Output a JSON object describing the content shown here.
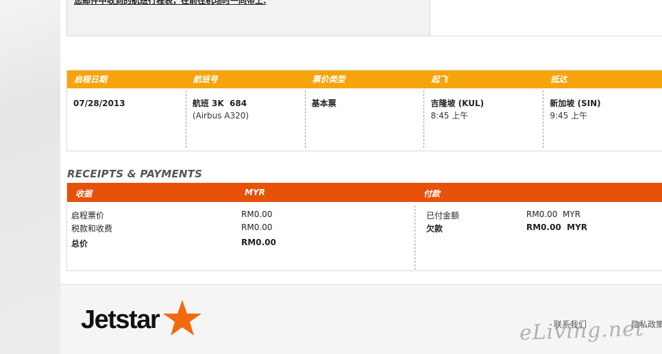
{
  "notice": {
    "text": "您邮件中收到的航班行程表，在前往机场时一同带上."
  },
  "flight": {
    "headers": [
      "启程日期",
      "航班号",
      "票价类型",
      "起飞",
      "抵达"
    ],
    "row": {
      "date": "07/28/2013",
      "flight_no": "航班 3K  684",
      "aircraft": "(Airbus A320)",
      "fare_type": "基本票",
      "depart_city": "吉隆坡 (KUL)",
      "depart_time": "8:45 上午",
      "arrive_city": "新加坡 (SIN)",
      "arrive_time": "9:45 上午"
    }
  },
  "receipts": {
    "title": "RECEIPTS & PAYMENTS",
    "head_receipts": "收据",
    "head_currency": "MYR",
    "head_payments": "付款",
    "base_fare_label": "启程票价",
    "base_fare_value": "RM0.00",
    "taxes_label": "税款和收费",
    "taxes_value": "RM0.00",
    "total_label": "总价",
    "total_value": "RM0.00",
    "paid_label": "已付金额",
    "paid_value": "RM0.00  MYR",
    "due_label": "欠款",
    "due_value": "RM0.00  MYR"
  },
  "footer": {
    "logo_text": "Jetstar",
    "contact_label": "联系我们",
    "privacy_label": "隐私政策",
    "watermark": "eLiving.net"
  },
  "colors": {
    "flight_header": "#f7a30a",
    "receipts_header": "#e8510a",
    "logo_star": "#f26a10"
  }
}
